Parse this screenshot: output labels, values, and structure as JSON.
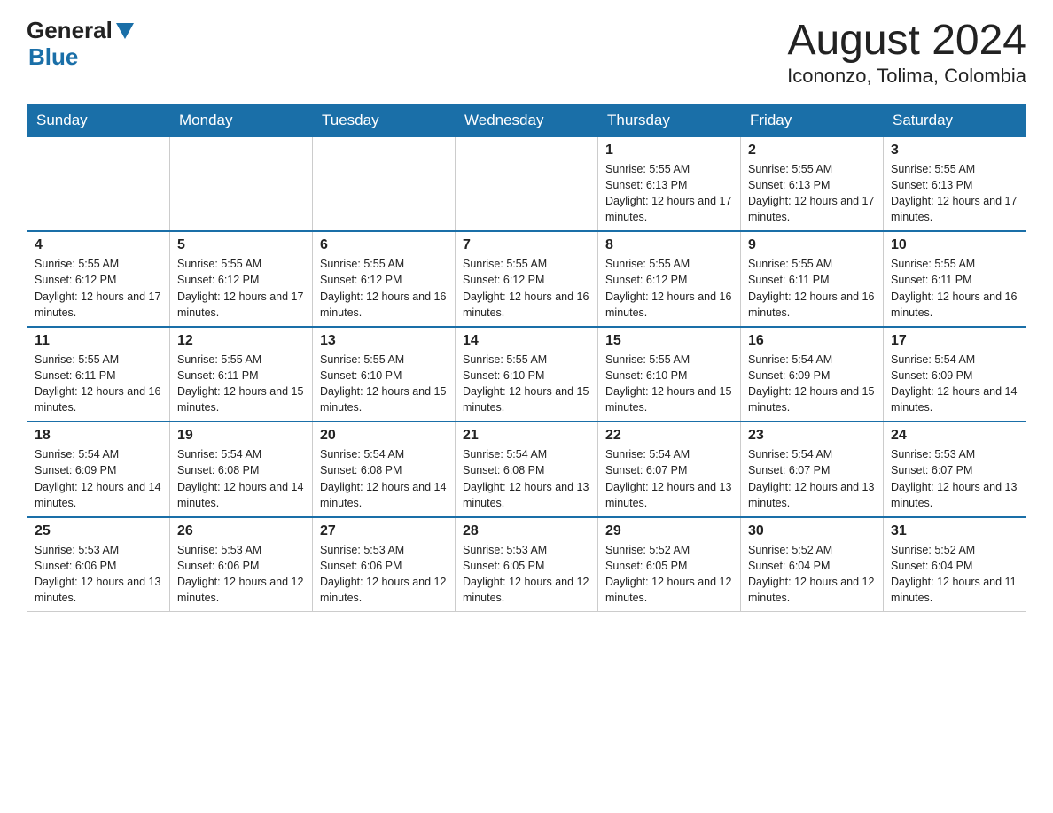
{
  "logo": {
    "general": "General",
    "blue": "Blue"
  },
  "title": "August 2024",
  "subtitle": "Icononzo, Tolima, Colombia",
  "days_of_week": [
    "Sunday",
    "Monday",
    "Tuesday",
    "Wednesday",
    "Thursday",
    "Friday",
    "Saturday"
  ],
  "weeks": [
    [
      {
        "day": "",
        "info": ""
      },
      {
        "day": "",
        "info": ""
      },
      {
        "day": "",
        "info": ""
      },
      {
        "day": "",
        "info": ""
      },
      {
        "day": "1",
        "info": "Sunrise: 5:55 AM\nSunset: 6:13 PM\nDaylight: 12 hours and 17 minutes."
      },
      {
        "day": "2",
        "info": "Sunrise: 5:55 AM\nSunset: 6:13 PM\nDaylight: 12 hours and 17 minutes."
      },
      {
        "day": "3",
        "info": "Sunrise: 5:55 AM\nSunset: 6:13 PM\nDaylight: 12 hours and 17 minutes."
      }
    ],
    [
      {
        "day": "4",
        "info": "Sunrise: 5:55 AM\nSunset: 6:12 PM\nDaylight: 12 hours and 17 minutes."
      },
      {
        "day": "5",
        "info": "Sunrise: 5:55 AM\nSunset: 6:12 PM\nDaylight: 12 hours and 17 minutes."
      },
      {
        "day": "6",
        "info": "Sunrise: 5:55 AM\nSunset: 6:12 PM\nDaylight: 12 hours and 16 minutes."
      },
      {
        "day": "7",
        "info": "Sunrise: 5:55 AM\nSunset: 6:12 PM\nDaylight: 12 hours and 16 minutes."
      },
      {
        "day": "8",
        "info": "Sunrise: 5:55 AM\nSunset: 6:12 PM\nDaylight: 12 hours and 16 minutes."
      },
      {
        "day": "9",
        "info": "Sunrise: 5:55 AM\nSunset: 6:11 PM\nDaylight: 12 hours and 16 minutes."
      },
      {
        "day": "10",
        "info": "Sunrise: 5:55 AM\nSunset: 6:11 PM\nDaylight: 12 hours and 16 minutes."
      }
    ],
    [
      {
        "day": "11",
        "info": "Sunrise: 5:55 AM\nSunset: 6:11 PM\nDaylight: 12 hours and 16 minutes."
      },
      {
        "day": "12",
        "info": "Sunrise: 5:55 AM\nSunset: 6:11 PM\nDaylight: 12 hours and 15 minutes."
      },
      {
        "day": "13",
        "info": "Sunrise: 5:55 AM\nSunset: 6:10 PM\nDaylight: 12 hours and 15 minutes."
      },
      {
        "day": "14",
        "info": "Sunrise: 5:55 AM\nSunset: 6:10 PM\nDaylight: 12 hours and 15 minutes."
      },
      {
        "day": "15",
        "info": "Sunrise: 5:55 AM\nSunset: 6:10 PM\nDaylight: 12 hours and 15 minutes."
      },
      {
        "day": "16",
        "info": "Sunrise: 5:54 AM\nSunset: 6:09 PM\nDaylight: 12 hours and 15 minutes."
      },
      {
        "day": "17",
        "info": "Sunrise: 5:54 AM\nSunset: 6:09 PM\nDaylight: 12 hours and 14 minutes."
      }
    ],
    [
      {
        "day": "18",
        "info": "Sunrise: 5:54 AM\nSunset: 6:09 PM\nDaylight: 12 hours and 14 minutes."
      },
      {
        "day": "19",
        "info": "Sunrise: 5:54 AM\nSunset: 6:08 PM\nDaylight: 12 hours and 14 minutes."
      },
      {
        "day": "20",
        "info": "Sunrise: 5:54 AM\nSunset: 6:08 PM\nDaylight: 12 hours and 14 minutes."
      },
      {
        "day": "21",
        "info": "Sunrise: 5:54 AM\nSunset: 6:08 PM\nDaylight: 12 hours and 13 minutes."
      },
      {
        "day": "22",
        "info": "Sunrise: 5:54 AM\nSunset: 6:07 PM\nDaylight: 12 hours and 13 minutes."
      },
      {
        "day": "23",
        "info": "Sunrise: 5:54 AM\nSunset: 6:07 PM\nDaylight: 12 hours and 13 minutes."
      },
      {
        "day": "24",
        "info": "Sunrise: 5:53 AM\nSunset: 6:07 PM\nDaylight: 12 hours and 13 minutes."
      }
    ],
    [
      {
        "day": "25",
        "info": "Sunrise: 5:53 AM\nSunset: 6:06 PM\nDaylight: 12 hours and 13 minutes."
      },
      {
        "day": "26",
        "info": "Sunrise: 5:53 AM\nSunset: 6:06 PM\nDaylight: 12 hours and 12 minutes."
      },
      {
        "day": "27",
        "info": "Sunrise: 5:53 AM\nSunset: 6:06 PM\nDaylight: 12 hours and 12 minutes."
      },
      {
        "day": "28",
        "info": "Sunrise: 5:53 AM\nSunset: 6:05 PM\nDaylight: 12 hours and 12 minutes."
      },
      {
        "day": "29",
        "info": "Sunrise: 5:52 AM\nSunset: 6:05 PM\nDaylight: 12 hours and 12 minutes."
      },
      {
        "day": "30",
        "info": "Sunrise: 5:52 AM\nSunset: 6:04 PM\nDaylight: 12 hours and 12 minutes."
      },
      {
        "day": "31",
        "info": "Sunrise: 5:52 AM\nSunset: 6:04 PM\nDaylight: 12 hours and 11 minutes."
      }
    ]
  ]
}
